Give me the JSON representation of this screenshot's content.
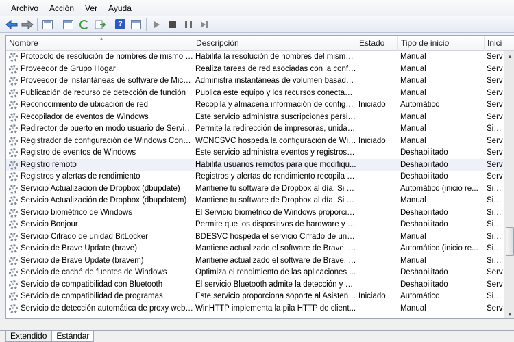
{
  "menu": [
    "Archivo",
    "Acción",
    "Ver",
    "Ayuda"
  ],
  "toolbar": {
    "icons": [
      "back-arrow-icon",
      "forward-arrow-icon",
      "show-console-tree-icon",
      "properties-icon",
      "refresh-icon",
      "export-list-icon",
      "help-icon",
      "console-icon",
      "start-service-icon",
      "stop-service-icon",
      "pause-service-icon",
      "restart-service-icon"
    ]
  },
  "columns": [
    "Nombre",
    "Descripción",
    "Estado",
    "Tipo de inicio",
    "Inici"
  ],
  "rows": [
    {
      "name": "Protocolo de resolución de nombres de mismo ni...",
      "desc": "Habilita la resolución de nombres del mismo...",
      "state": "",
      "type": "Manual",
      "init": "Serv"
    },
    {
      "name": "Proveedor de Grupo Hogar",
      "desc": "Realiza tareas de red asociadas con la config...",
      "state": "",
      "type": "Manual",
      "init": "Serv"
    },
    {
      "name": "Proveedor de instantáneas de software de Micros...",
      "desc": "Administra instantáneas de volumen basada...",
      "state": "",
      "type": "Manual",
      "init": "Serv"
    },
    {
      "name": "Publicación de recurso de detección de función",
      "desc": "Publica este equipo y los recursos conectado...",
      "state": "",
      "type": "Manual",
      "init": "Serv"
    },
    {
      "name": "Reconocimiento de ubicación de red",
      "desc": "Recopila y almacena información de configu...",
      "state": "Iniciado",
      "type": "Automático",
      "init": "Serv"
    },
    {
      "name": "Recopilador de eventos de Windows",
      "desc": "Este servicio administra suscripciones persist...",
      "state": "",
      "type": "Manual",
      "init": "Serv"
    },
    {
      "name": "Redirector de puerto en modo usuario de Servicio...",
      "desc": "Permite la redirección de impresoras, unidad...",
      "state": "",
      "type": "Manual",
      "init": "Siste"
    },
    {
      "name": "Registrador de configuración de Windows Conne...",
      "desc": "WCNCSVC hospeda la configuración de Win...",
      "state": "Iniciado",
      "type": "Manual",
      "init": "Serv"
    },
    {
      "name": "Registro de eventos de Windows",
      "desc": "Este servicio administra eventos y registros d...",
      "state": "",
      "type": "Deshabilitado",
      "init": "Serv"
    },
    {
      "name": "Registro remoto",
      "desc": "Habilita usuarios remotos para que modifiqu...",
      "state": "",
      "type": "Deshabilitado",
      "init": "Serv"
    },
    {
      "name": "Registros y alertas de rendimiento",
      "desc": "Registros y alertas de rendimiento recopila in...",
      "state": "",
      "type": "Deshabilitado",
      "init": "Serv"
    },
    {
      "name": "Servicio Actualización de Dropbox (dbupdate)",
      "desc": "Mantiene tu software de Dropbox al día. Si es...",
      "state": "",
      "type": "Automático (inicio re...",
      "init": "Siste"
    },
    {
      "name": "Servicio Actualización de Dropbox (dbupdatem)",
      "desc": "Mantiene tu software de Dropbox al día. Si es...",
      "state": "",
      "type": "Manual",
      "init": "Siste"
    },
    {
      "name": "Servicio biométrico de Windows",
      "desc": "El Servicio biométrico de Windows proporcio...",
      "state": "",
      "type": "Deshabilitado",
      "init": "Siste"
    },
    {
      "name": "Servicio Bonjour",
      "desc": "Permite que los dispositivos de hardware y lo...",
      "state": "",
      "type": "Deshabilitado",
      "init": "Siste"
    },
    {
      "name": "Servicio Cifrado de unidad BitLocker",
      "desc": "BDESVC hospeda el servicio Cifrado de unida...",
      "state": "",
      "type": "Manual",
      "init": "Siste"
    },
    {
      "name": "Servicio de Brave Update (brave)",
      "desc": "Mantiene actualizado el software de Brave. Si...",
      "state": "",
      "type": "Automático (inicio re...",
      "init": "Siste"
    },
    {
      "name": "Servicio de Brave Update (bravem)",
      "desc": "Mantiene actualizado el software de Brave. Si...",
      "state": "",
      "type": "Manual",
      "init": "Siste"
    },
    {
      "name": "Servicio de caché de fuentes de Windows",
      "desc": "Optimiza el rendimiento de las aplicaciones ...",
      "state": "",
      "type": "Deshabilitado",
      "init": "Serv"
    },
    {
      "name": "Servicio de compatibilidad con Bluetooth",
      "desc": "El servicio Bluetooth admite la detección y as...",
      "state": "",
      "type": "Deshabilitado",
      "init": "Serv"
    },
    {
      "name": "Servicio de compatibilidad de programas",
      "desc": "Este servicio proporciona soporte al Asistent...",
      "state": "Iniciado",
      "type": "Automático",
      "init": "Siste"
    },
    {
      "name": "Servicio de detección automática de proxy web ...",
      "desc": "WinHTTP implementa la pila HTTP de client...",
      "state": "",
      "type": "Manual",
      "init": "Serv"
    }
  ],
  "tabs": [
    "Extendido",
    "Estándar"
  ]
}
